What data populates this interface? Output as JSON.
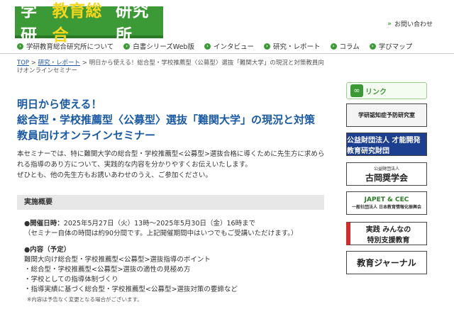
{
  "header": {
    "logo_part1": "学研",
    "logo_part2": "教育総合",
    "logo_part3": "研究所",
    "contact": "お問い合わせ"
  },
  "nav": {
    "items": [
      {
        "label": "学研教育総合研究所について"
      },
      {
        "label": "白書シリーズWeb版"
      },
      {
        "label": "インタビュー"
      },
      {
        "label": "研究・レポート"
      },
      {
        "label": "コラム"
      },
      {
        "label": "学びマップ"
      }
    ]
  },
  "breadcrumb": {
    "top": "TOP",
    "sep": " > ",
    "reports": "研究・レポート",
    "current": "明日から使える！総合型・学校推薦型〈公募型〉選抜「難関大学」の現況と対策教員向けオンラインセミナー"
  },
  "article": {
    "title_line1": "明日から使える！",
    "title_line2": "総合型・学校推薦型〈公募型〉選抜「難関大学」の現況と対策",
    "title_line3": "教員向けオンラインセミナー",
    "intro_line1": "本セミナーでは、特に難関大学の総合型・学校推薦型<公募型>選抜合格に導くために先生方に求められる指導のあり方について、実践的な内容を分かりやすくお伝えいたします。",
    "intro_line2": "ぜひとも、他の先生方もお誘いあわせのうえ、ご参加ください。",
    "section_title": "実施概要",
    "date_label": "●開催日時：",
    "date_value": "2025年5月27日（火）13時～2025年5月30日（金）16時まで",
    "date_note": "（セミナー自体の時間は約90分間です。上記開催期間中はいつでもご受講いただけます。）",
    "content_label": "●内容（予定）",
    "content_items": [
      "難関大向け総合型・学校推薦型<公募型>選抜指導のポイント",
      "・総合型・学校推薦型<公募型>選抜の適性の見極め方",
      "・学校としての指導体制づくり",
      "・指導実績に基づく総合型・学校推薦型<公募型>選抜対策の要締など"
    ],
    "content_note": "※内容は予告なく変更となる場合がございます。"
  },
  "sidebar": {
    "heading": "リンク",
    "banners": [
      {
        "line1": "学研認知症予防研究室"
      },
      {
        "line1": "公益財団法人 才能開発教育研究財団"
      },
      {
        "sub": "公益財団法人",
        "line1": "古岡奨学会"
      },
      {
        "line1": "JAPET & CEC",
        "sub": "一般社団法人 日本教育情報化振興会"
      },
      {
        "line1": "実践 みんなの",
        "line2": "特別支援教育"
      },
      {
        "line1": "教育ジャーナル"
      }
    ]
  },
  "colors": {
    "brand_green": "#3c9a36",
    "logo_yellow": "#f6d51a",
    "title_blue": "#1a5aa5",
    "link_blue": "#1a55a6"
  }
}
